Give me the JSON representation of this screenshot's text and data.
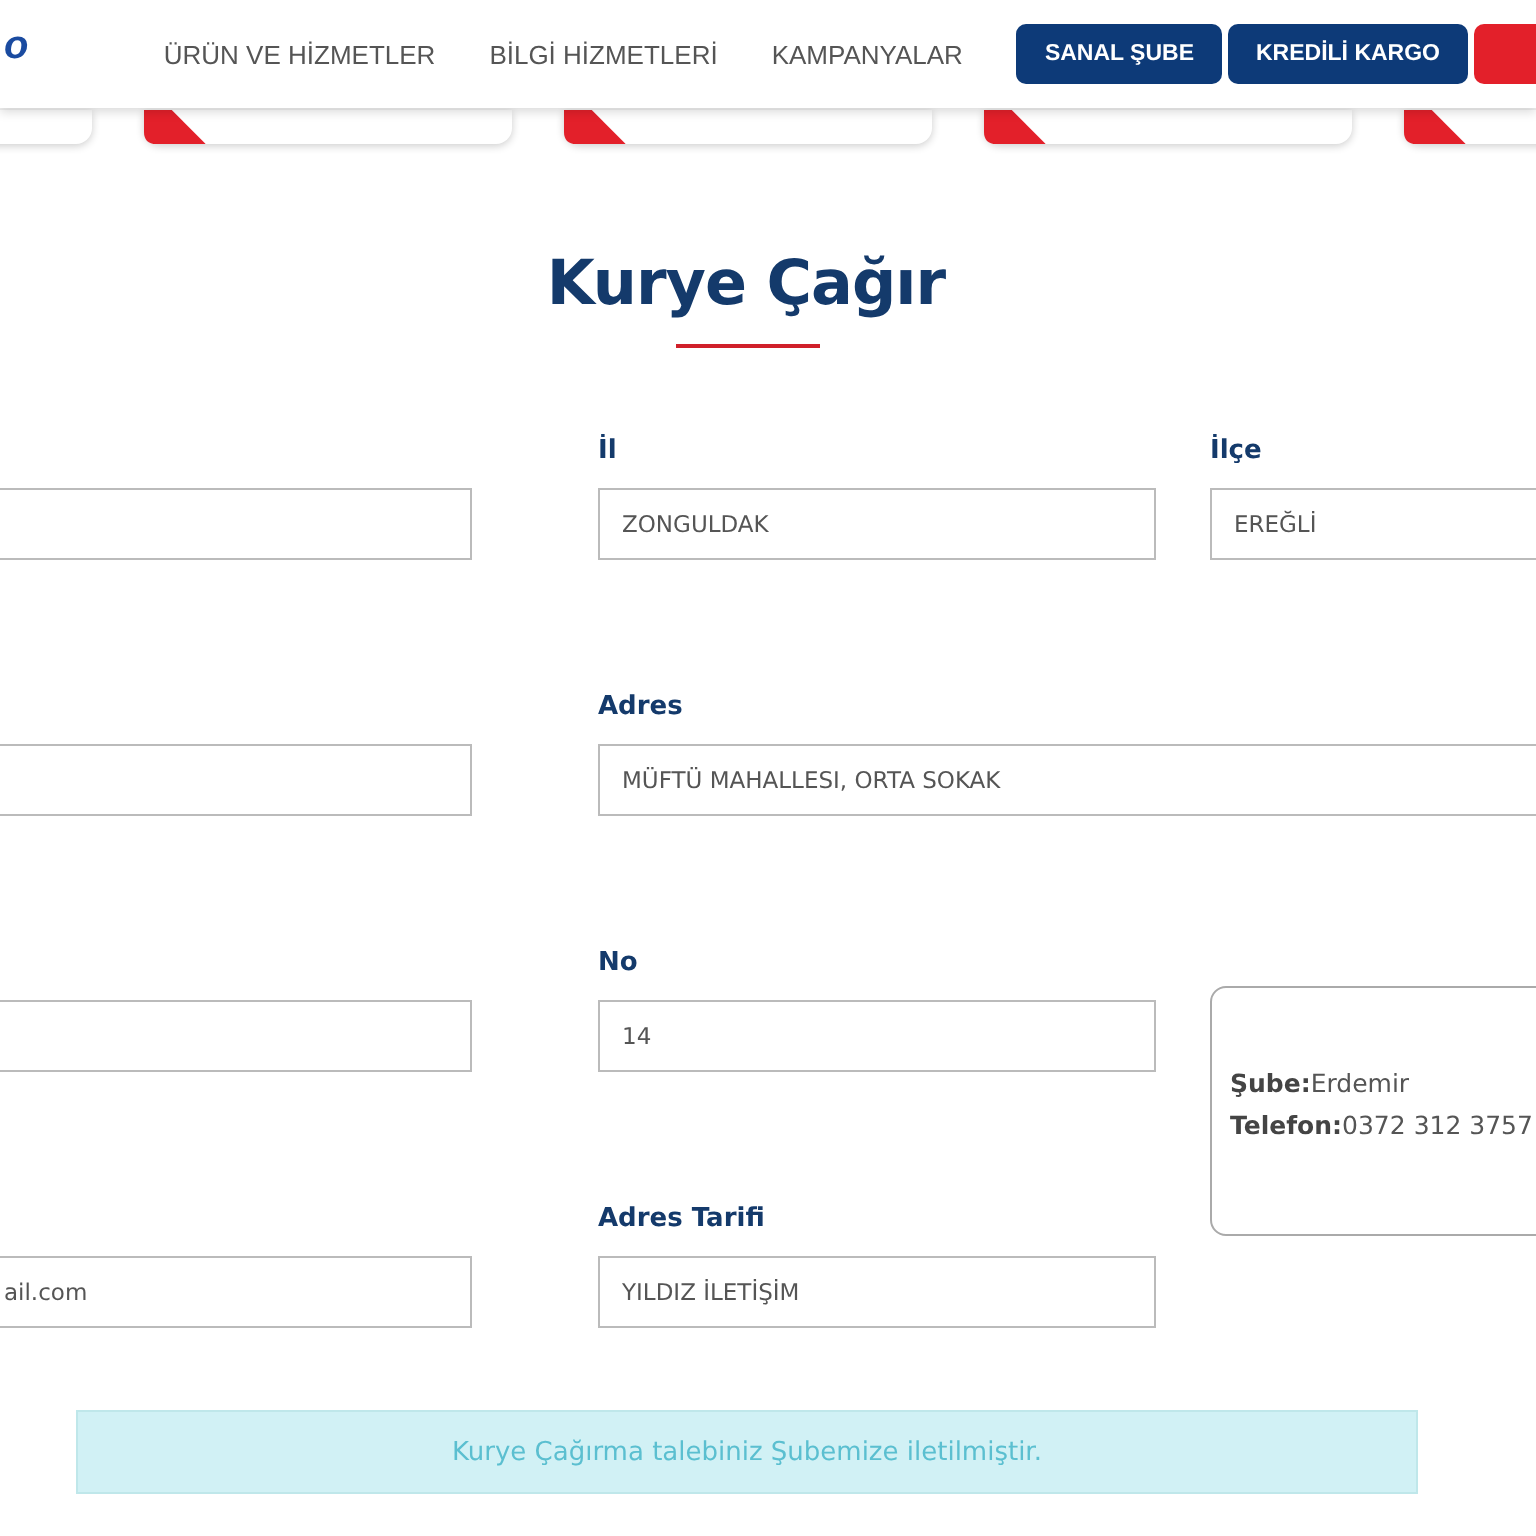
{
  "header": {
    "logo": "o",
    "nav": [
      "ÜRÜN VE HİZMETLER",
      "BİLGİ HİZMETLERİ",
      "KAMPANYALAR"
    ],
    "buttons": [
      {
        "label": "SANAL ŞUBE",
        "kind": "primary"
      },
      {
        "label": "KREDİLİ KARGO",
        "kind": "primary"
      },
      {
        "kind": "accent"
      }
    ]
  },
  "cards": [
    {
      "kind": "plain"
    },
    {
      "kind": "card"
    },
    {
      "kind": "card"
    },
    {
      "kind": "card"
    },
    {
      "kind": "card"
    }
  ],
  "title": "Kurye Çağır",
  "rows": [
    [
      {
        "kind": "input"
      },
      {
        "kind": "input",
        "label": "İl",
        "value": "ZONGULDAK"
      },
      {
        "kind": "input",
        "label": "İlçe",
        "value": "EREĞLİ"
      }
    ],
    [
      {
        "kind": "input"
      },
      {
        "kind": "wide",
        "label": "Adres",
        "value": "MÜFTÜ MAHALLESI, ORTA SOKAK"
      }
    ],
    [
      {
        "kind": "input"
      },
      {
        "kind": "input",
        "label": "No",
        "value": "14"
      },
      {
        "kind": "info",
        "lines": [
          {
            "key": "Şube:",
            "value": "Erdemir"
          },
          {
            "key": "Telefon:",
            "value": "0372 312 3757"
          }
        ]
      }
    ],
    [
      {
        "kind": "input",
        "value": "ail.com"
      },
      {
        "kind": "input",
        "label": "Adres Tarifi",
        "value": "YILDIZ İLETİŞİM"
      }
    ]
  ],
  "alert": "Kurye Çağırma talebiniz Şubemize iletilmiştir."
}
